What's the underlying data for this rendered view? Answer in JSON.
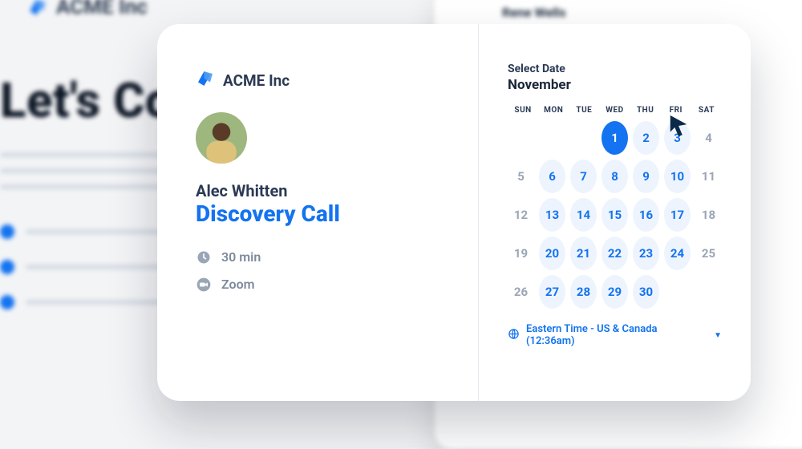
{
  "background": {
    "brand": "ACME Inc",
    "headline": "Let's Con",
    "card_name": "Rene Wells"
  },
  "modal": {
    "brand": "ACME Inc",
    "host": "Alec Whitten",
    "event_title": "Discovery Call",
    "duration": "30 min",
    "location": "Zoom",
    "select_label": "Select Date",
    "month": "November",
    "dow": [
      "SUN",
      "MON",
      "TUE",
      "WED",
      "THU",
      "FRI",
      "SAT"
    ],
    "weeks": [
      [
        {
          "t": "blank"
        },
        {
          "t": "blank"
        },
        {
          "t": "blank"
        },
        {
          "d": 1,
          "t": "sel"
        },
        {
          "d": 2,
          "t": "avail"
        },
        {
          "d": 3,
          "t": "avail"
        },
        {
          "d": 4,
          "t": "off"
        }
      ],
      [
        {
          "d": 5,
          "t": "off"
        },
        {
          "d": 6,
          "t": "avail"
        },
        {
          "d": 7,
          "t": "avail"
        },
        {
          "d": 8,
          "t": "avail"
        },
        {
          "d": 9,
          "t": "avail"
        },
        {
          "d": 10,
          "t": "avail"
        },
        {
          "d": 11,
          "t": "off"
        }
      ],
      [
        {
          "d": 12,
          "t": "off"
        },
        {
          "d": 13,
          "t": "avail"
        },
        {
          "d": 14,
          "t": "avail"
        },
        {
          "d": 15,
          "t": "avail"
        },
        {
          "d": 16,
          "t": "avail"
        },
        {
          "d": 17,
          "t": "avail"
        },
        {
          "d": 18,
          "t": "off"
        }
      ],
      [
        {
          "d": 19,
          "t": "off"
        },
        {
          "d": 20,
          "t": "avail"
        },
        {
          "d": 21,
          "t": "avail"
        },
        {
          "d": 22,
          "t": "avail"
        },
        {
          "d": 23,
          "t": "avail"
        },
        {
          "d": 24,
          "t": "avail"
        },
        {
          "d": 25,
          "t": "off"
        }
      ],
      [
        {
          "d": 26,
          "t": "off"
        },
        {
          "d": 27,
          "t": "avail"
        },
        {
          "d": 28,
          "t": "avail"
        },
        {
          "d": 29,
          "t": "avail"
        },
        {
          "d": 30,
          "t": "avail"
        },
        {
          "t": "blank"
        },
        {
          "t": "blank"
        }
      ]
    ],
    "timezone": "Eastern Time - US & Canada (12:36am)"
  }
}
